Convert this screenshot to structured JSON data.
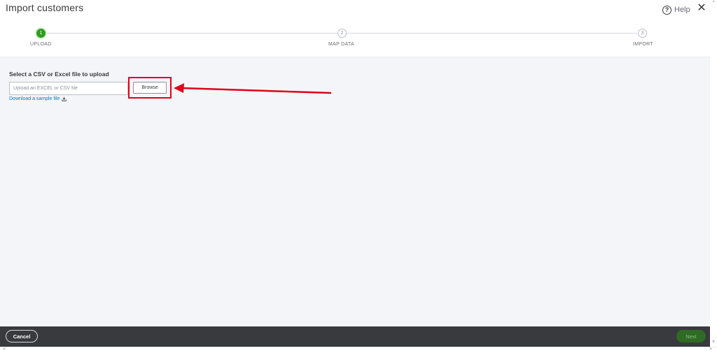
{
  "header": {
    "title": "Import customers",
    "help_icon": "question-circle-icon",
    "help_label": "Help",
    "close_icon": "close-icon",
    "close_glyph": "✕"
  },
  "stepper": {
    "steps": [
      {
        "number": "1",
        "label": "UPLOAD",
        "active": true
      },
      {
        "number": "2",
        "label": "MAP DATA",
        "active": false
      },
      {
        "number": "3",
        "label": "IMPORT",
        "active": false
      }
    ]
  },
  "upload": {
    "title": "Select a CSV or Excel file to upload",
    "input_placeholder": "Upload an EXCEL or CSV file",
    "input_value": "",
    "browse_label": "Browse",
    "sample_link": "Download a sample file",
    "sample_icon": "download-icon"
  },
  "annotation": {
    "highlight_color": "#e2001a",
    "arrow_color": "#e2001a"
  },
  "footer": {
    "cancel_label": "Cancel",
    "next_label": "Next"
  },
  "scrollbars": {
    "up_glyph": "^",
    "down_glyph": "v",
    "left_glyph": "<",
    "right_glyph": ">"
  },
  "colors": {
    "brand_green": "#2ca01c",
    "footer_bg": "#393a3d",
    "link_blue": "#0077c5"
  }
}
